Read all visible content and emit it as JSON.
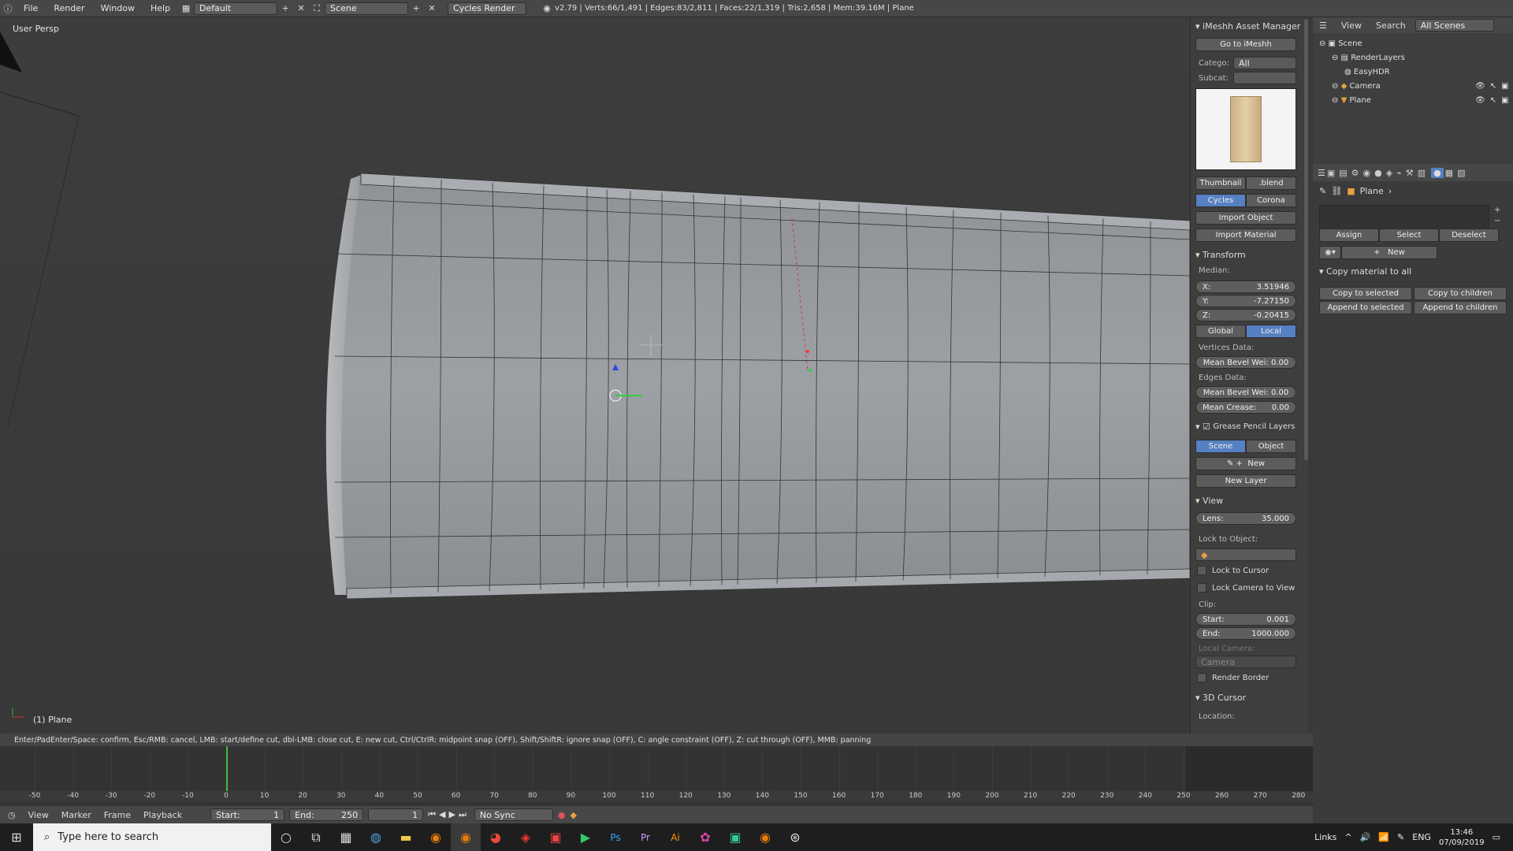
{
  "topbar": {
    "menus": [
      "File",
      "Render",
      "Window",
      "Help"
    ],
    "layout": "Default",
    "scene": "Scene",
    "engine": "Cycles Render",
    "stats": "v2.79 | Verts:66/1,491 | Edges:83/2,811 | Faces:22/1,319 | Tris:2,658 | Mem:39.16M | Plane"
  },
  "viewport": {
    "title": "User Persp",
    "object": "(1) Plane"
  },
  "imeshh": {
    "header": "iMeshh Asset Manager",
    "goto": "Go to iMeshh",
    "category_label": "Catego:",
    "category_value": "All",
    "subcat_label": "Subcat:",
    "subcat_value": "",
    "thumbnail": "Thumbnail",
    "blend": ".blend",
    "engine_tabs": [
      "Cycles",
      "Corona"
    ],
    "import_object": "Import Object",
    "import_material": "Import Material"
  },
  "transform": {
    "header": "Transform",
    "median": "Median:",
    "x_label": "X:",
    "x": "3.51946",
    "y_label": "Y:",
    "y": "-7.27150",
    "z_label": "Z:",
    "z": "-0.20415",
    "space_tabs": [
      "Global",
      "Local"
    ],
    "vertices_data": "Vertices Data:",
    "mean_bevel_v": "Mean Bevel Wei: 0.00",
    "edges_data": "Edges Data:",
    "mean_bevel_e": "Mean Bevel Wei: 0.00",
    "mean_crease_label": "Mean Crease:",
    "mean_crease": "0.00"
  },
  "grease": {
    "header": "Grease Pencil Layers",
    "tabs": [
      "Scene",
      "Object"
    ],
    "new": "New",
    "new_layer": "New Layer"
  },
  "view": {
    "header": "View",
    "lens_label": "Lens:",
    "lens": "35.000",
    "lock_object": "Lock to Object:",
    "lock_cursor": "Lock to Cursor",
    "lock_camera": "Lock Camera to View",
    "clip": "Clip:",
    "start_label": "Start:",
    "start": "0.001",
    "end_label": "End:",
    "end": "1000.000",
    "local_camera": "Local Camera:",
    "camera": "Camera",
    "render_border": "Render Border",
    "cursor_header": "3D Cursor",
    "location": "Location:"
  },
  "outliner": {
    "view": "View",
    "search": "Search",
    "all_scenes": "All Scenes",
    "items": [
      "Scene",
      "RenderLayers",
      "EasyHDR",
      "Camera",
      "Plane"
    ]
  },
  "properties": {
    "object": "Plane",
    "assign": "Assign",
    "select": "Select",
    "deselect": "Deselect",
    "new": "New",
    "copy_header": "Copy material to all",
    "copy_selected": "Copy to selected",
    "copy_children": "Copy to children",
    "append_selected": "Append to selected",
    "append_children": "Append to children"
  },
  "hint": "Enter/PadEnter/Space: confirm, Esc/RMB: cancel, LMB: start/define cut, dbl-LMB: close cut, E: new cut, Ctrl/CtrlR: midpoint snap (OFF), Shift/ShiftR: ignore snap (OFF), C: angle constraint (OFF), Z: cut through (OFF), MMB: panning",
  "timeline": {
    "ticks": [
      "-50",
      "-40",
      "-30",
      "-20",
      "-10",
      "0",
      "10",
      "20",
      "30",
      "40",
      "50",
      "60",
      "70",
      "80",
      "90",
      "100",
      "110",
      "120",
      "130",
      "140",
      "150",
      "160",
      "170",
      "180",
      "190",
      "200",
      "210",
      "220",
      "230",
      "240",
      "250",
      "260",
      "270",
      "280"
    ],
    "menus": [
      "View",
      "Marker",
      "Frame",
      "Playback"
    ],
    "start_label": "Start:",
    "start": "1",
    "end_label": "End:",
    "end": "250",
    "current": "1",
    "sync": "No Sync"
  },
  "taskbar": {
    "search_placeholder": "Type here to search",
    "links": "Links",
    "lang": "ENG",
    "time": "13:46",
    "date": "07/09/2019"
  },
  "colors": {
    "accent": "#5680c2",
    "panel": "#3e3e3e",
    "header": "#474747"
  }
}
